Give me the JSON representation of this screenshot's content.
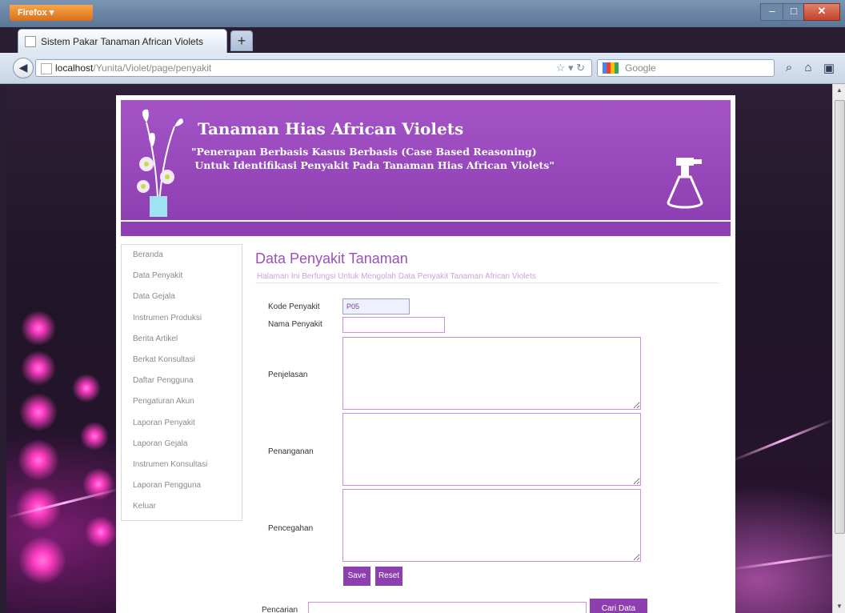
{
  "browser": {
    "menu_label": "Firefox",
    "tab_title": "Sistem Pakar Tanaman African Violets",
    "new_tab": "+",
    "url_host": "localhost",
    "url_path": "/Yunita/Violet/page/penyakit",
    "search_placeholder": "Google",
    "icons": [
      "back-arrow-icon",
      "star-icon",
      "reload-icon",
      "google-logo-icon",
      "search-icon",
      "home-icon",
      "addon-icon"
    ]
  },
  "header": {
    "title": "Tanaman Hias African Violets",
    "subtitle": "\"Penerapan Berbasis Kasus Berbasis (Case Based Reasoning)\n Untuk Identifikasi Penyakit Pada Tanaman Hias African Violets\"",
    "accent_color": "#8e3fb2"
  },
  "sidebar": {
    "items": [
      {
        "label": "Beranda"
      },
      {
        "label": "Data Penyakit"
      },
      {
        "label": "Data Gejala"
      },
      {
        "label": "Instrumen Produksi"
      },
      {
        "label": "Berita Artikel"
      },
      {
        "label": "Berkat Konsultasi"
      },
      {
        "label": "Daftar Pengguna"
      },
      {
        "label": "Pengaturan Akun"
      },
      {
        "label": "Laporan Penyakit"
      },
      {
        "label": "Laporan Gejala"
      },
      {
        "label": "Instrumen Konsultasi"
      },
      {
        "label": "Laporan Pengguna"
      },
      {
        "label": "Keluar"
      }
    ]
  },
  "main": {
    "title": "Data Penyakit Tanaman",
    "description": "Halaman Ini Berfungsi Untuk Mengolah Data Penyakit Tanaman African Violets",
    "form": {
      "kode_label": "Kode Penyakit",
      "kode_value": "P05",
      "nama_label": "Nama Penyakit",
      "nama_value": "",
      "penjelasan_label": "Penjelasan",
      "penanganan_label": "Penanganan",
      "pencegahan_label": "Pencegahan",
      "save_label": "Save",
      "reset_label": "Reset"
    },
    "search": {
      "label": "Pencarian",
      "value": "",
      "button_label": "Cari Data"
    }
  }
}
